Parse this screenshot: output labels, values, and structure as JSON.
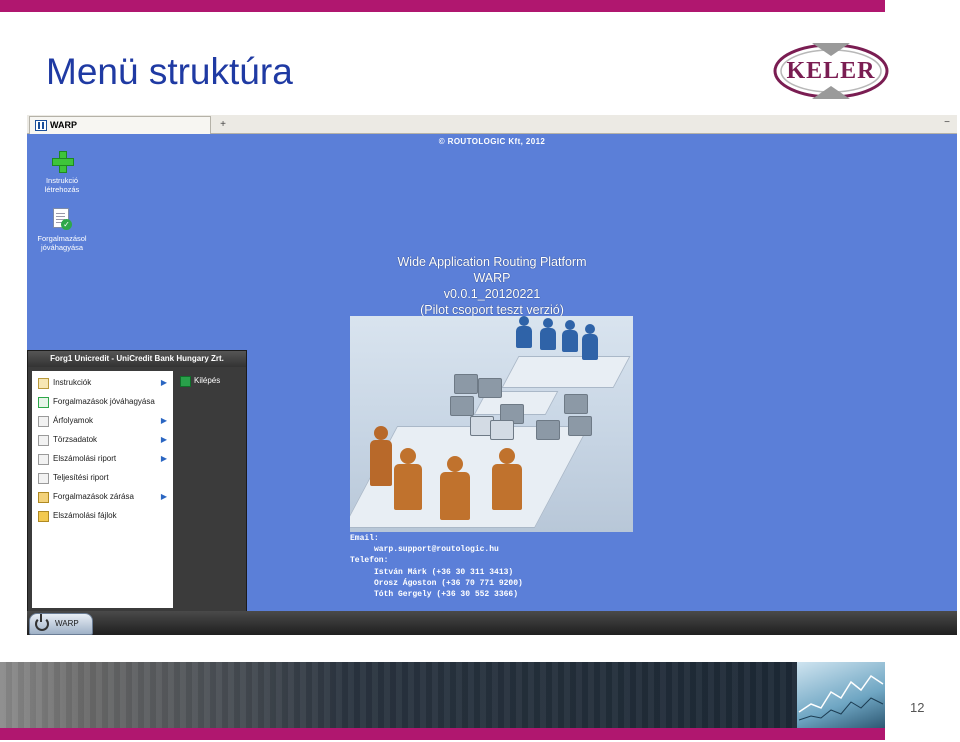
{
  "slide": {
    "title": "Menü struktúra",
    "page_number": "12",
    "logo_text": "KELER",
    "accent_color": "#b0176f",
    "title_color": "#1f3aa3"
  },
  "window": {
    "tab_label": "WARP",
    "tab_add_icon": "+",
    "minimize_icon": "−"
  },
  "desktop_icons": [
    {
      "icon": "plus-icon",
      "label_line1": "Instrukció",
      "label_line2": "létrehozás"
    },
    {
      "icon": "document-check-icon",
      "label_line1": "Forgalmazásol",
      "label_line2": "jóváhagyása"
    }
  ],
  "copyright": "© ROUTOLOGIC Kft, 2012",
  "app_info": {
    "line1": "Wide Application Routing Platform",
    "line2": "WARP",
    "line3": "v0.0.1_20120221",
    "line4": "(Pilot csoport teszt verzió)"
  },
  "contact": {
    "email_label": "Email:",
    "email": "warp.support@routologic.hu",
    "phone_label": "Telefon:",
    "people": [
      "István Márk (+36 30 311 3413)",
      "Orosz Ágoston (+36 70 771 9200)",
      "Tóth Gergely (+36 30 552 3366)"
    ]
  },
  "start_menu": {
    "header": "Forg1 Unicredit - UniCredit Bank Hungary Zrt.",
    "items": [
      {
        "label": "Instrukciók",
        "has_submenu": true,
        "icon": "clipboard-icon"
      },
      {
        "label": "Forgalmazások jóváhagyása",
        "has_submenu": false,
        "icon": "document-check-icon"
      },
      {
        "label": "Árfolyamok",
        "has_submenu": true,
        "icon": "chart-icon"
      },
      {
        "label": "Törzsadatok",
        "has_submenu": true,
        "icon": "list-icon"
      },
      {
        "label": "Elszámolási riport",
        "has_submenu": true,
        "icon": "report-icon"
      },
      {
        "label": "Teljesítési riport",
        "has_submenu": false,
        "icon": "table-icon"
      },
      {
        "label": "Forgalmazások zárása",
        "has_submenu": true,
        "icon": "lock-icon"
      },
      {
        "label": "Elszámolási fájlok",
        "has_submenu": false,
        "icon": "folder-icon"
      }
    ],
    "submenu_arrow": "▶",
    "exit_label": "Kilépés"
  },
  "taskbar": {
    "start_label": "WARP"
  }
}
